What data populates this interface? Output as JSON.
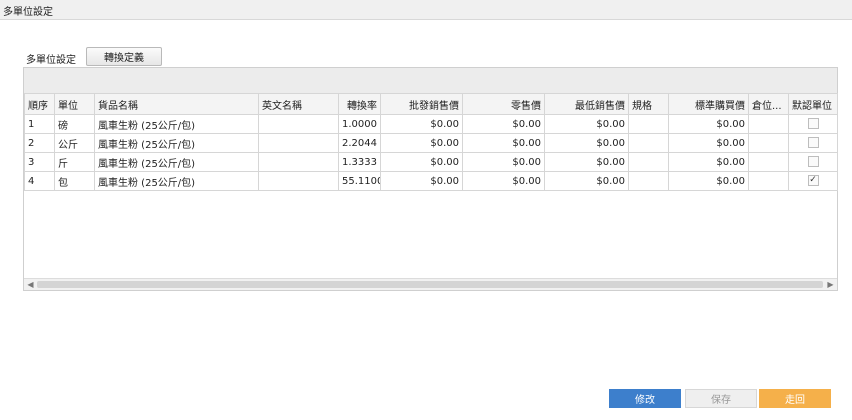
{
  "window": {
    "title": "多單位設定"
  },
  "section": {
    "label": "多單位設定",
    "define_button": "轉換定義"
  },
  "grid": {
    "columns": [
      "順序",
      "單位",
      "貨品名稱",
      "英文名稱",
      "轉換率",
      "批發銷售價",
      "零售價",
      "最低銷售價",
      "規格",
      "標準購買價",
      "倉位...",
      "默認單位"
    ],
    "rows": [
      {
        "seq": "1",
        "unit": "磅",
        "name": "風車生粉 (25公斤/包)",
        "english": "",
        "rate": "1.0000",
        "wholesale": "$0.00",
        "retail": "$0.00",
        "min_price": "$0.00",
        "spec": "",
        "std_purchase": "$0.00",
        "location": "",
        "default": false
      },
      {
        "seq": "2",
        "unit": "公斤",
        "name": "風車生粉 (25公斤/包)",
        "english": "",
        "rate": "2.2044",
        "wholesale": "$0.00",
        "retail": "$0.00",
        "min_price": "$0.00",
        "spec": "",
        "std_purchase": "$0.00",
        "location": "",
        "default": false
      },
      {
        "seq": "3",
        "unit": "斤",
        "name": "風車生粉 (25公斤/包)",
        "english": "",
        "rate": "1.3333",
        "wholesale": "$0.00",
        "retail": "$0.00",
        "min_price": "$0.00",
        "spec": "",
        "std_purchase": "$0.00",
        "location": "",
        "default": false
      },
      {
        "seq": "4",
        "unit": "包",
        "name": "風車生粉 (25公斤/包)",
        "english": "",
        "rate": "55.1100",
        "wholesale": "$0.00",
        "retail": "$0.00",
        "min_price": "$0.00",
        "spec": "",
        "std_purchase": "$0.00",
        "location": "",
        "default": true
      }
    ]
  },
  "footer": {
    "edit": "修改",
    "save": "保存",
    "leave": "走回"
  },
  "colors": {
    "edit": "#3d7fcc",
    "leave": "#f5b04a"
  }
}
